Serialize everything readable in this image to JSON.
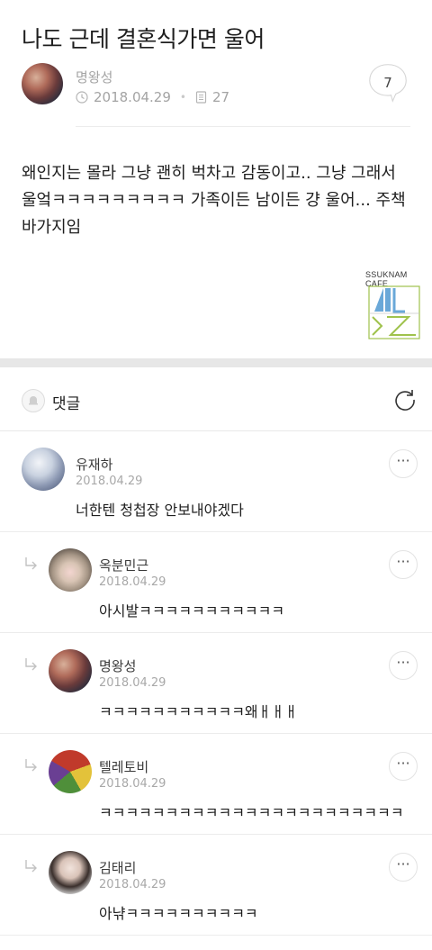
{
  "post": {
    "title": "나도 근데 결혼식가면 울어",
    "author": "명왕성",
    "date": "2018.04.29",
    "views": "27",
    "comment_count": "7",
    "body": "왜인지는 몰라 그냥 괜히 벅차고 감동이고.. 그냥 그래서 울엌ㅋㅋㅋㅋㅋㅋㅋㅋㅋ 가족이든 남이든 걍 울어... 주책바가지임",
    "logo_text": "SSUKNAM CAFE"
  },
  "comments_section": {
    "label": "댓글",
    "items": [
      {
        "name": "유재하",
        "date": "2018.04.29",
        "text": "너한텐 청첩장 안보내야겠다",
        "reply": false
      },
      {
        "name": "옥분민근",
        "date": "2018.04.29",
        "text": "아시발ㅋㅋㅋㅋㅋㅋㅋㅋㅋㅋㅋ",
        "reply": true
      },
      {
        "name": "명왕성",
        "date": "2018.04.29",
        "text": "ㅋㅋㅋㅋㅋㅋㅋㅋㅋㅋㅋ왜ㅐㅐㅐ",
        "reply": true
      },
      {
        "name": "텔레토비",
        "date": "2018.04.29",
        "text": "ㅋㅋㅋㅋㅋㅋㅋㅋㅋㅋㅋㅋㅋㅋㅋㅋㅋㅋㅋㅋㅋㅋㅋ",
        "reply": true
      },
      {
        "name": "김태리",
        "date": "2018.04.29",
        "text": "아냒ㅋㅋㅋㅋㅋㅋㅋㅋㅋㅋ",
        "reply": true
      }
    ],
    "more_label": "···"
  },
  "icons": {
    "clock": "clock-icon",
    "document": "document-icon",
    "bell": "bell-icon",
    "refresh": "refresh-icon",
    "reply": "reply-arrow-icon",
    "more": "more-icon"
  },
  "colors": {
    "band": "#e7e7e7",
    "meta": "#a4a4a4",
    "logo_blue": "#6aa8d8",
    "logo_green": "#9fc24c"
  }
}
